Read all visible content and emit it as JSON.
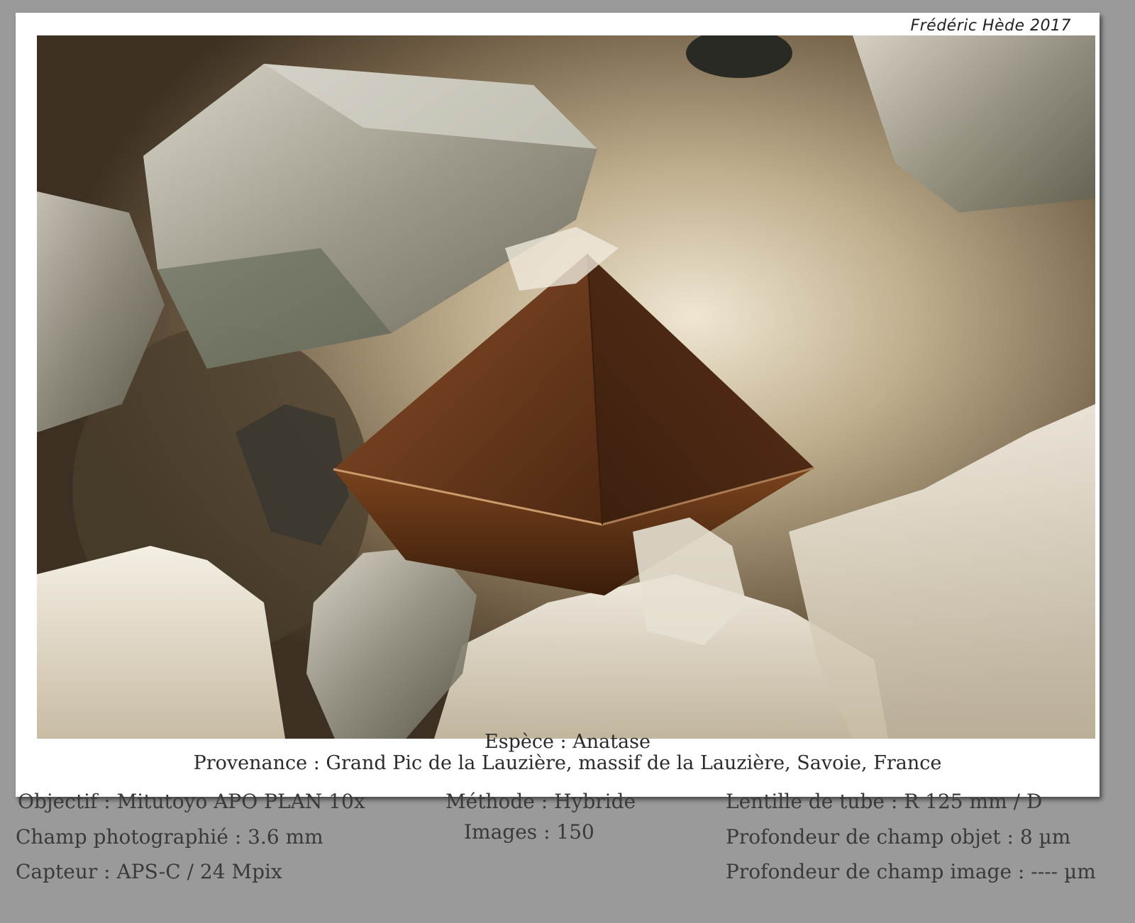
{
  "credit": "Frédéric Hède 2017",
  "caption": {
    "species": "Espèce : Anatase",
    "origin": "Provenance : Grand Pic de la Lauzière, massif de la Lauzière, Savoie, France"
  },
  "info": {
    "objective": "Objectif : Mitutoyo APO PLAN 10x",
    "field": "Champ photographié : 3.6 mm",
    "sensor": "Capteur : APS-C / 24 Mpix",
    "method": "Méthode : Hybride",
    "images": "Images : 150",
    "tube_lens": "Lentille de tube : R 125 mm / D",
    "dof_object": "Profondeur de champ objet : 8 µm",
    "dof_image": "Profondeur de champ image : ---- µm"
  },
  "colors": {
    "background": "#9a9a9a",
    "frame": "#ffffff",
    "crystal": "#6b3a1c"
  }
}
